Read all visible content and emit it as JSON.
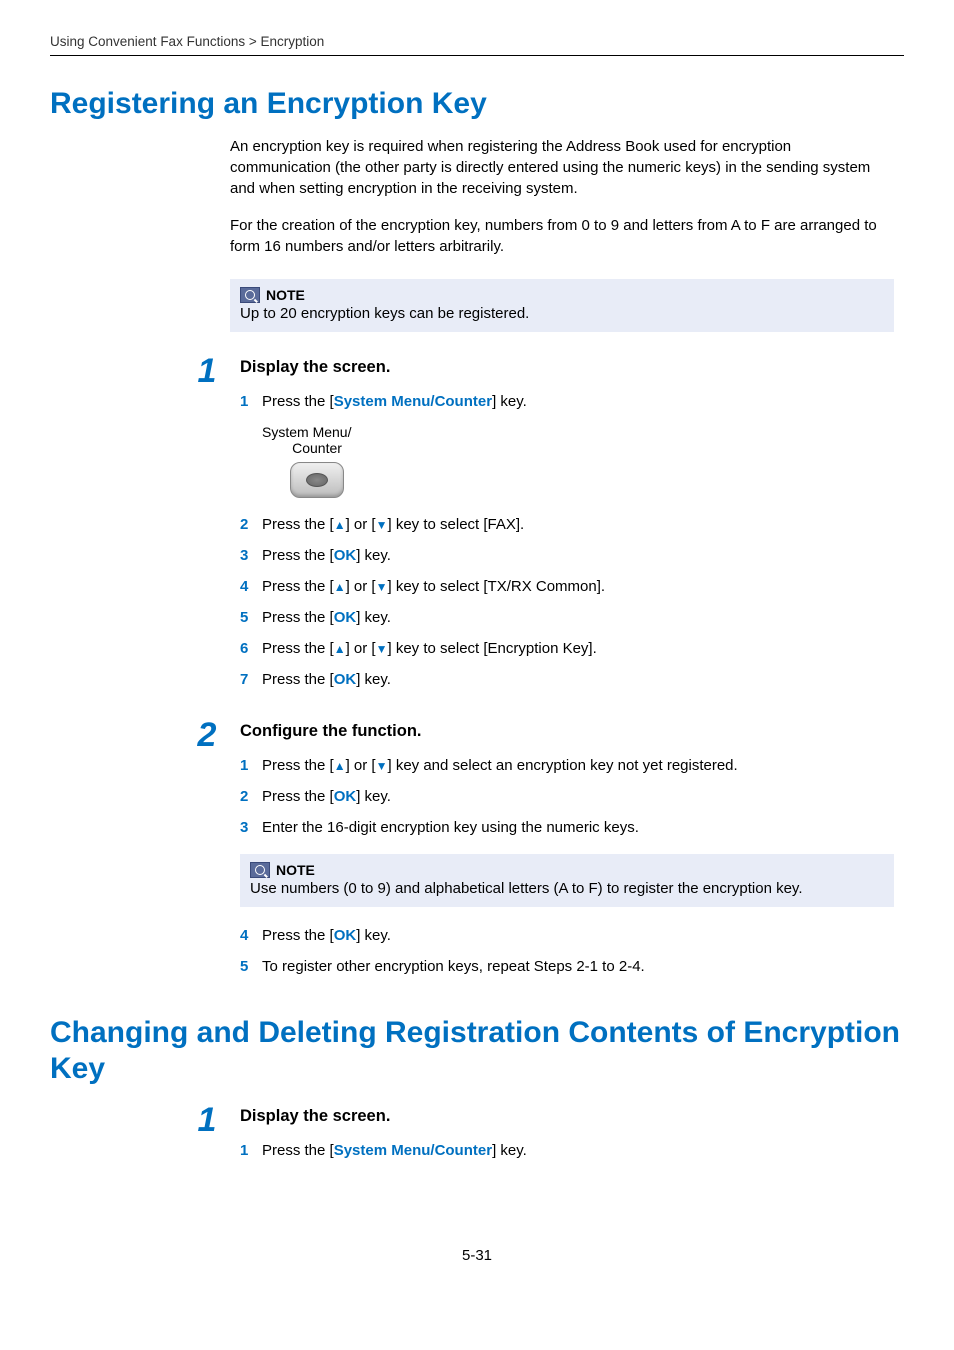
{
  "breadcrumb": "Using Convenient Fax Functions > Encryption",
  "heading1": "Registering an Encryption Key",
  "intro_p1": "An encryption key is required when registering the Address Book used for encryption communication (the other party is directly entered using the numeric keys) in the sending system and when setting encryption in the receiving system.",
  "intro_p2": "For the creation of the encryption key, numbers from 0 to 9 and letters from A to F are arranged to form 16 numbers and/or letters arbitrarily.",
  "note1_label": "NOTE",
  "note1_body": "Up to 20 encryption keys can be registered.",
  "step1_num": "1",
  "step1_title": "Display the screen.",
  "step1_sub1_num": "1",
  "step1_sub1_pre": "Press the [",
  "step1_sub1_link": "System Menu/Counter",
  "step1_sub1_post": "] key.",
  "key_label_line1": "System Menu/",
  "key_label_line2": "Counter",
  "step1_sub2_num": "2",
  "step1_sub2_a": "Press the [",
  "step1_sub2_b": "] or [",
  "step1_sub2_c": "] key to select [FAX].",
  "step1_sub3_num": "3",
  "step1_sub3_a": "Press the [",
  "step1_sub3_ok": "OK",
  "step1_sub3_b": "] key.",
  "step1_sub4_num": "4",
  "step1_sub4_a": "Press the [",
  "step1_sub4_b": "] or [",
  "step1_sub4_c": "] key to select [TX/RX Common].",
  "step1_sub5_num": "5",
  "step1_sub5_a": "Press the [",
  "step1_sub5_ok": "OK",
  "step1_sub5_b": "] key.",
  "step1_sub6_num": "6",
  "step1_sub6_a": "Press the [",
  "step1_sub6_b": "] or [",
  "step1_sub6_c": "] key to select [Encryption Key].",
  "step1_sub7_num": "7",
  "step1_sub7_a": "Press the [",
  "step1_sub7_ok": "OK",
  "step1_sub7_b": "] key.",
  "step2_num": "2",
  "step2_title": "Configure the function.",
  "step2_sub1_num": "1",
  "step2_sub1_a": "Press the [",
  "step2_sub1_b": "] or [",
  "step2_sub1_c": "] key and select an encryption key not yet registered.",
  "step2_sub2_num": "2",
  "step2_sub2_a": "Press the [",
  "step2_sub2_ok": "OK",
  "step2_sub2_b": "] key.",
  "step2_sub3_num": "3",
  "step2_sub3_text": "Enter the 16-digit encryption key using the numeric keys.",
  "note2_label": "NOTE",
  "note2_body": "Use numbers (0 to 9) and alphabetical letters (A to F) to register the encryption key.",
  "step2_sub4_num": "4",
  "step2_sub4_a": "Press the [",
  "step2_sub4_ok": "OK",
  "step2_sub4_b": "] key.",
  "step2_sub5_num": "5",
  "step2_sub5_text": "To register other encryption keys, repeat Steps 2-1 to 2-4.",
  "heading2": "Changing and Deleting Registration Contents of Encryption Key",
  "step3_num": "1",
  "step3_title": "Display the screen.",
  "step3_sub1_num": "1",
  "step3_sub1_pre": "Press the [",
  "step3_sub1_link": "System Menu/Counter",
  "step3_sub1_post": "] key.",
  "page_number": "5-31",
  "glyphs": {
    "up": "▲",
    "down": "▼"
  }
}
